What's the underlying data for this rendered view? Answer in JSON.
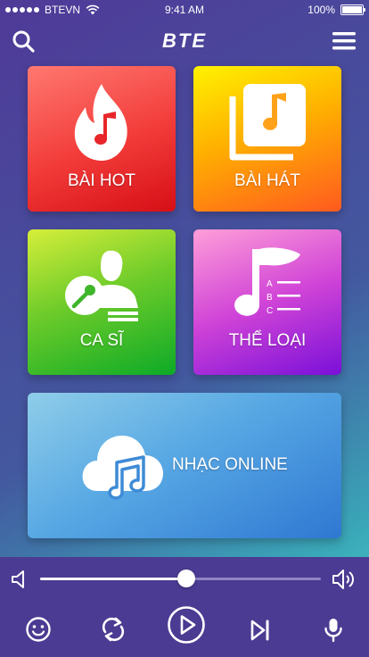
{
  "status_bar": {
    "carrier": "BTEVN",
    "time": "9:41 AM",
    "battery": "100%"
  },
  "header": {
    "logo": "BTE"
  },
  "tiles": {
    "hot": {
      "label": "BÀI HOT",
      "icon": "fire-music-icon"
    },
    "songs": {
      "label": "BÀI HÁT",
      "icon": "music-album-icon"
    },
    "artists": {
      "label": "CA SĨ",
      "icon": "singer-microphone-icon"
    },
    "genres": {
      "label": "THỂ LOẠI",
      "icon": "music-list-icon"
    },
    "online": {
      "label": "NHẠC ONLINE",
      "icon": "cloud-music-icon"
    }
  },
  "player": {
    "volume_level": 0.52,
    "controls": [
      "emoji-icon",
      "repeat-icon",
      "play-icon",
      "skip-next-icon",
      "microphone-icon"
    ]
  }
}
